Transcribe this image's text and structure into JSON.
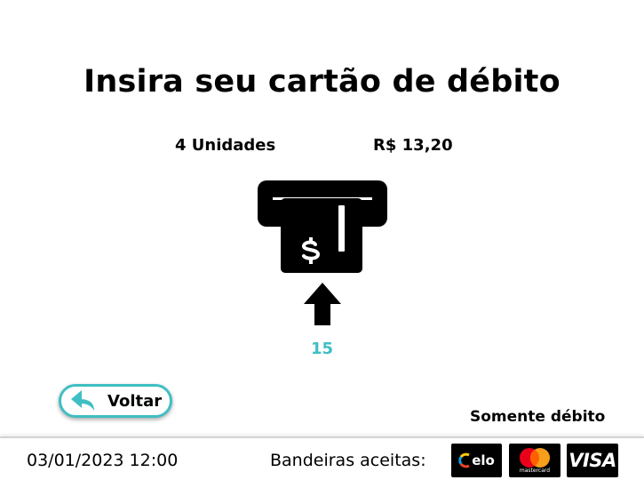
{
  "screen": {
    "title": "Insira seu cartão de débito",
    "quantity": "4 Unidades",
    "price": "R$ 13,20",
    "countdown": "15"
  },
  "back_button": {
    "label": "Voltar",
    "icon": "reply-arrow-icon"
  },
  "payment": {
    "debit_only": "Somente débito",
    "accepted_label": "Bandeiras aceitas:",
    "brands": [
      {
        "name": "elo",
        "label": "elo"
      },
      {
        "name": "mastercard",
        "label": "mastercard"
      },
      {
        "name": "visa",
        "label": "VISA"
      }
    ]
  },
  "footer": {
    "datetime": "03/01/2023 12:00"
  },
  "colors": {
    "accent": "#3fbfc3",
    "text": "#000000",
    "background": "#ffffff",
    "mastercard_red": "#eb001b",
    "mastercard_orange": "#f79e1b",
    "elo_yellow": "#ffcb05",
    "elo_blue": "#00a4e0",
    "elo_red": "#ef4123"
  },
  "icons": {
    "card_insert": "card-insert-icon",
    "arrow": "arrow-up-icon"
  }
}
